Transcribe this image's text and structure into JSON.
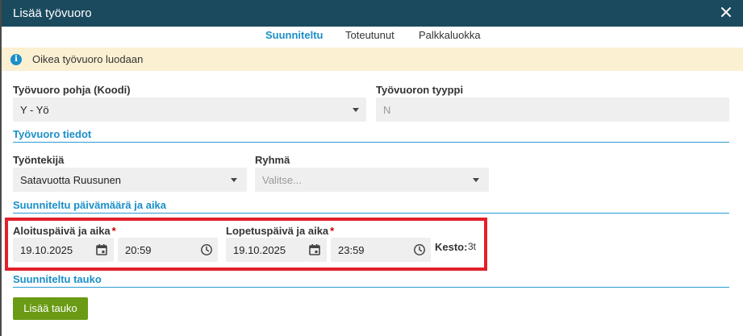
{
  "dialog": {
    "title": "Lisää työvuoro"
  },
  "tabs": [
    {
      "label": "Suunniteltu",
      "active": true
    },
    {
      "label": "Toteutunut",
      "active": false
    },
    {
      "label": "Palkkaluokka",
      "active": false
    }
  ],
  "notice": {
    "text": "Oikea työvuoro luodaan",
    "icon": "info-icon"
  },
  "shift_template": {
    "label": "Työvuoro pohja (Koodi)",
    "value": "Y - Yö"
  },
  "shift_type": {
    "label": "Työvuoron tyyppi",
    "value": "N"
  },
  "section_details": {
    "title": "Työvuoro tiedot"
  },
  "employee": {
    "label": "Työntekijä",
    "value": "Satavuotta Ruusunen"
  },
  "group": {
    "label": "Ryhmä",
    "placeholder": "Valitse..."
  },
  "section_datetime": {
    "title": "Suunniteltu päivämäärä ja aika"
  },
  "start": {
    "label": "Aloituspäivä ja aika",
    "required": "*",
    "date": "19.10.2025",
    "time": "20:59"
  },
  "end": {
    "label": "Lopetuspäivä ja aika",
    "required": "*",
    "date": "19.10.2025",
    "time": "23:59"
  },
  "duration": {
    "label": "Kesto:",
    "value": "3t"
  },
  "section_break": {
    "title": "Suunniteltu tauko"
  },
  "add_break_button": {
    "label": "Lisää tauko"
  },
  "colors": {
    "titlebar": "#1b4a5e",
    "accent": "#1a8fc9",
    "notice_bg": "#fbf0d2",
    "button": "#6b9a14",
    "highlight": "#e2202a"
  }
}
